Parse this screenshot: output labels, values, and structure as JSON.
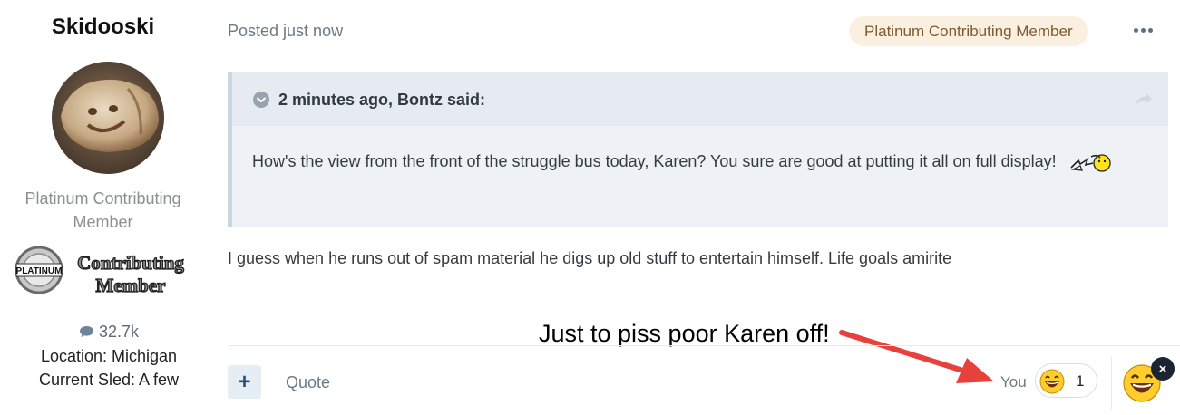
{
  "author": {
    "name": "Skidooski",
    "rank_title": "Platinum Contributing Member",
    "badge_text_line1": "Contributing",
    "badge_text_line2": "Member",
    "badge_seal_text": "PLATINUM",
    "content_count": "32.7k",
    "location": "Location: Michigan",
    "current_sled": "Current Sled: A few"
  },
  "post": {
    "posted": "Posted just now",
    "group_badge": "Platinum Contributing Member",
    "more_icon": "ellipsis-icon",
    "quote": {
      "citation": "2 minutes ago, Bontz said:",
      "text": "How's the view from the front of the struggle bus today, Karen?  You sure are good at putting it all on full display!",
      "toggle_icon": "chevron-down-circle-icon",
      "share_icon": "share-arrow-icon"
    },
    "body": "I guess when he runs out of spam material he digs up old stuff to entertain himself. Life goals amirite"
  },
  "annotation": {
    "text": "Just to piss poor Karen off!",
    "arrow_color": "#e8413c"
  },
  "footer": {
    "quote_label": "Quote",
    "plus_icon": "plus-icon",
    "reacted_by": "You",
    "reaction_count": "1",
    "reaction_icon": "laughing-face-icon",
    "remove_icon": "close-icon"
  },
  "colors": {
    "pill_bg": "#fbf0df",
    "quote_bg": "#eef2f6",
    "accent": "#2c4f74"
  }
}
